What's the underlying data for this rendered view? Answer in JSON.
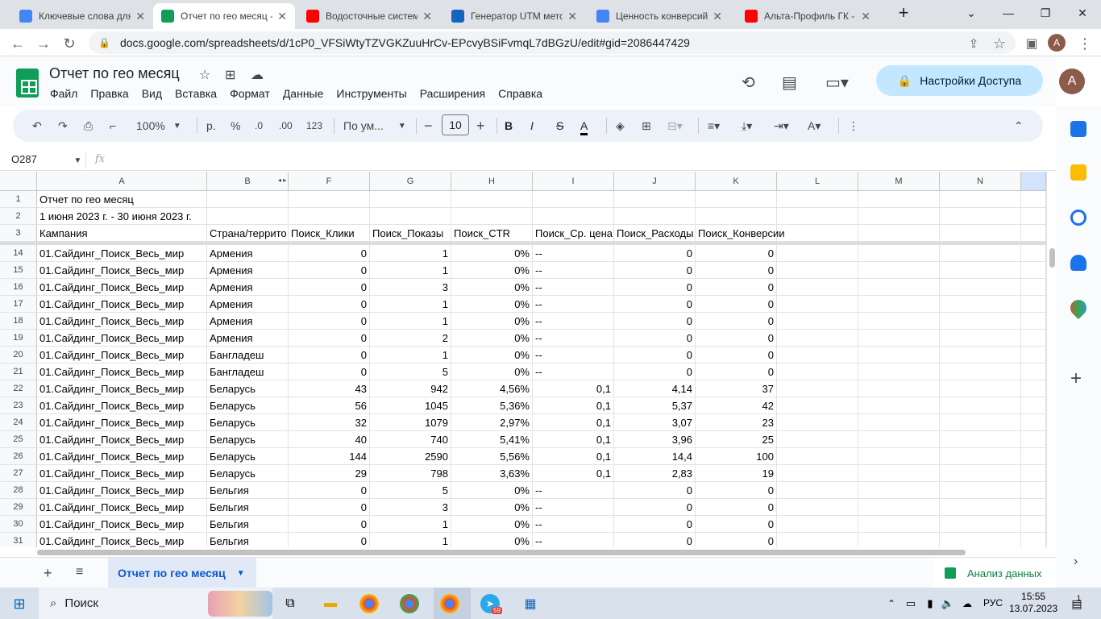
{
  "browser": {
    "tabs": [
      {
        "title": "Ключевые слова для",
        "favicon": "ads-icon",
        "color": "#4285f4"
      },
      {
        "title": "Отчет по гео месяц -",
        "favicon": "sheets-icon",
        "color": "#0f9d58",
        "active": true
      },
      {
        "title": "Водосточные систем",
        "favicon": "youtube-icon",
        "color": "#ff0000"
      },
      {
        "title": "Генератор UTM мето",
        "favicon": "utm-icon",
        "color": "#1565c0"
      },
      {
        "title": "Ценность конверсий",
        "favicon": "google-icon",
        "color": "#4285f4"
      },
      {
        "title": "Альта-Профиль ГК -",
        "favicon": "youtube-icon",
        "color": "#ff0000"
      }
    ],
    "url": "docs.google.com/spreadsheets/d/1cP0_VFSiWtyTZVGKZuuHrCv-EPcvyBSiFvmqL7dBGzU/edit#gid=2086447429",
    "profile_initial": "A"
  },
  "doc": {
    "title": "Отчет по гео месяц",
    "menu": [
      "Файл",
      "Правка",
      "Вид",
      "Вставка",
      "Формат",
      "Данные",
      "Инструменты",
      "Расширения",
      "Справка"
    ],
    "share_label": "Настройки Доступа",
    "avatar_initial": "A"
  },
  "toolbar": {
    "zoom": "100%",
    "currency": "р.",
    "percent": "%",
    "dec_less": ".0",
    "dec_more": ".00",
    "format_123": "123",
    "font": "По ум...",
    "font_size": "10"
  },
  "formula_bar": {
    "cell_ref": "O287",
    "fx": "fx",
    "content": ""
  },
  "grid": {
    "columns": [
      "A",
      "B",
      "F",
      "G",
      "H",
      "I",
      "J",
      "K",
      "L",
      "M",
      "N"
    ],
    "frozen_rows": [
      {
        "num": "1",
        "cells": [
          "Отчет по гео месяц",
          "",
          "",
          "",
          "",
          "",
          "",
          "",
          "",
          "",
          ""
        ]
      },
      {
        "num": "2",
        "cells": [
          "1 июня 2023 г. - 30 июня 2023 г.",
          "",
          "",
          "",
          "",
          "",
          "",
          "",
          "",
          "",
          ""
        ]
      },
      {
        "num": "3",
        "cells": [
          "Кампания",
          "Страна/террито",
          "Поиск_Клики",
          "Поиск_Показы",
          "Поиск_CTR",
          "Поиск_Ср. цена",
          "Поиск_Расходы",
          "Поиск_Конверсии",
          "",
          "",
          ""
        ]
      }
    ],
    "rows": [
      {
        "num": "14",
        "cells": [
          "01.Сайдинг_Поиск_Весь_мир",
          "Армения",
          "0",
          "1",
          "0%",
          "--",
          "0",
          "0"
        ]
      },
      {
        "num": "15",
        "cells": [
          "01.Сайдинг_Поиск_Весь_мир",
          "Армения",
          "0",
          "1",
          "0%",
          "--",
          "0",
          "0"
        ]
      },
      {
        "num": "16",
        "cells": [
          "01.Сайдинг_Поиск_Весь_мир",
          "Армения",
          "0",
          "3",
          "0%",
          "--",
          "0",
          "0"
        ]
      },
      {
        "num": "17",
        "cells": [
          "01.Сайдинг_Поиск_Весь_мир",
          "Армения",
          "0",
          "1",
          "0%",
          "--",
          "0",
          "0"
        ]
      },
      {
        "num": "18",
        "cells": [
          "01.Сайдинг_Поиск_Весь_мир",
          "Армения",
          "0",
          "1",
          "0%",
          "--",
          "0",
          "0"
        ]
      },
      {
        "num": "19",
        "cells": [
          "01.Сайдинг_Поиск_Весь_мир",
          "Армения",
          "0",
          "2",
          "0%",
          "--",
          "0",
          "0"
        ]
      },
      {
        "num": "20",
        "cells": [
          "01.Сайдинг_Поиск_Весь_мир",
          "Бангладеш",
          "0",
          "1",
          "0%",
          "--",
          "0",
          "0"
        ]
      },
      {
        "num": "21",
        "cells": [
          "01.Сайдинг_Поиск_Весь_мир",
          "Бангладеш",
          "0",
          "5",
          "0%",
          "--",
          "0",
          "0"
        ]
      },
      {
        "num": "22",
        "cells": [
          "01.Сайдинг_Поиск_Весь_мир",
          "Беларусь",
          "43",
          "942",
          "4,56%",
          "0,1",
          "4,14",
          "37"
        ]
      },
      {
        "num": "23",
        "cells": [
          "01.Сайдинг_Поиск_Весь_мир",
          "Беларусь",
          "56",
          "1045",
          "5,36%",
          "0,1",
          "5,37",
          "42"
        ]
      },
      {
        "num": "24",
        "cells": [
          "01.Сайдинг_Поиск_Весь_мир",
          "Беларусь",
          "32",
          "1079",
          "2,97%",
          "0,1",
          "3,07",
          "23"
        ]
      },
      {
        "num": "25",
        "cells": [
          "01.Сайдинг_Поиск_Весь_мир",
          "Беларусь",
          "40",
          "740",
          "5,41%",
          "0,1",
          "3,96",
          "25"
        ]
      },
      {
        "num": "26",
        "cells": [
          "01.Сайдинг_Поиск_Весь_мир",
          "Беларусь",
          "144",
          "2590",
          "5,56%",
          "0,1",
          "14,4",
          "100"
        ]
      },
      {
        "num": "27",
        "cells": [
          "01.Сайдинг_Поиск_Весь_мир",
          "Беларусь",
          "29",
          "798",
          "3,63%",
          "0,1",
          "2,83",
          "19"
        ]
      },
      {
        "num": "28",
        "cells": [
          "01.Сайдинг_Поиск_Весь_мир",
          "Бельгия",
          "0",
          "5",
          "0%",
          "--",
          "0",
          "0"
        ]
      },
      {
        "num": "29",
        "cells": [
          "01.Сайдинг_Поиск_Весь_мир",
          "Бельгия",
          "0",
          "3",
          "0%",
          "--",
          "0",
          "0"
        ]
      },
      {
        "num": "30",
        "cells": [
          "01.Сайдинг_Поиск_Весь_мир",
          "Бельгия",
          "0",
          "1",
          "0%",
          "--",
          "0",
          "0"
        ]
      },
      {
        "num": "31",
        "cells": [
          "01.Сайдинг_Поиск_Весь_мир",
          "Бельгия",
          "0",
          "1",
          "0%",
          "--",
          "0",
          "0"
        ]
      }
    ]
  },
  "sheets": {
    "active_sheet": "Отчет по гео месяц",
    "explore_label": "Анализ данных"
  },
  "taskbar": {
    "search": "Поиск",
    "lang": "РУС",
    "time": "15:55",
    "date": "13.07.2023",
    "telegram_badge": "59",
    "notif_count": "1"
  }
}
